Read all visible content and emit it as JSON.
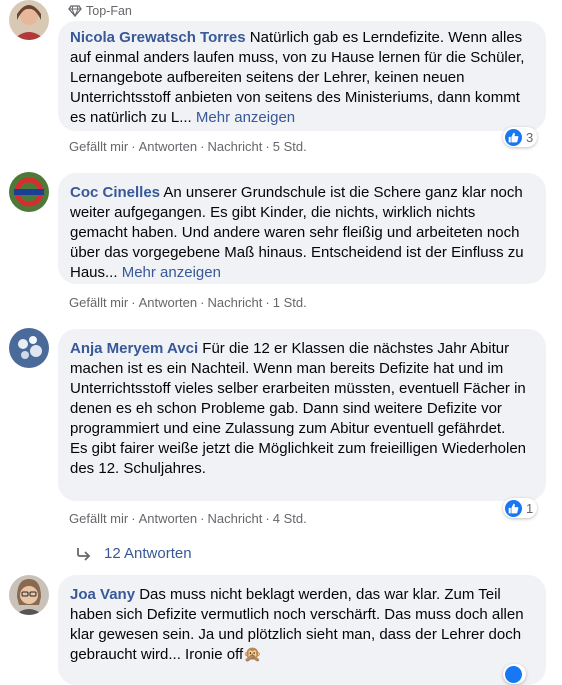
{
  "comments": [
    {
      "badge": "Top-Fan",
      "author": "Nicola Grewatsch Torres",
      "text": "Natürlich gab es Lerndefizite. Wenn alles auf einmal anders laufen muss, von zu Hause lernen für die Schüler, Lernangebote aufbereiten seitens der Lehrer, keinen neuen Unterrichtsstoff anbieten von seitens des Ministeriums, dann kommt es natürlich zu L...",
      "more": "Mehr anzeigen",
      "like": "Gefällt mir",
      "reply": "Antworten",
      "message": "Nachricht",
      "time": "5 Std.",
      "reactions": "3",
      "reaction_icon": "like-icon"
    },
    {
      "author": "Coc Cinelles",
      "text": "An unserer Grundschule ist die Schere ganz klar noch weiter aufgegangen. Es gibt Kinder, die nichts, wirklich nichts gemacht haben. Und andere waren sehr fleißig und arbeiteten noch über das vorgegebene Maß hinaus. Entscheidend ist der Einfluss zu Haus...",
      "more": "Mehr anzeigen",
      "like": "Gefällt mir",
      "reply": "Antworten",
      "message": "Nachricht",
      "time": "1 Std."
    },
    {
      "author": "Anja Meryem Avci",
      "text": "Für die 12 er Klassen die nächstes Jahr Abitur machen ist es ein Nachteil. Wenn man bereits Defizite hat und im Unterrichtsstoff vieles selber erarbeiten müssten, eventuell Fächer in denen es eh schon Probleme gab. Dann sind weitere Defizite vor programmiert und eine Zulassung zum Abitur eventuell gefährdet.\nEs gibt fairer weiße jetzt die Möglichkeit zum freieilligen Wiederholen des 12. Schuljahres.",
      "like": "Gefällt mir",
      "reply": "Antworten",
      "message": "Nachricht",
      "time": "4 Std.",
      "reactions": "1",
      "reaction_icon": "like-icon",
      "replies_label": "12 Antworten"
    },
    {
      "author": "Joa Vany",
      "text": "Das muss nicht beklagt werden, das war klar. Zum Teil haben sich Defizite vermutlich noch verschärft. Das muss doch allen klar gewesen sein. Ja und plötzlich sieht man, dass der Lehrer doch gebraucht wird... Ironie off",
      "emoji": "🙊",
      "emoji_icon": "monkey-face-icon"
    }
  ],
  "colors": {
    "name": "#385898",
    "meta": "#65676b",
    "bubble": "#f0f2f5",
    "like": "#1877f2"
  }
}
